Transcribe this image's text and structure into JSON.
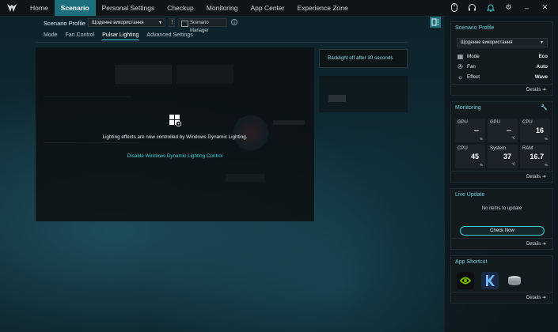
{
  "nav": {
    "items": [
      "Home",
      "Scenario",
      "Personal Settings",
      "Checkup",
      "Monitoring",
      "App Center",
      "Experience Zone"
    ],
    "active": "Scenario"
  },
  "scenario_bar": {
    "label": "Scenario Profile",
    "profile": "Щоденне використання",
    "manager_label": "Scenario Manager"
  },
  "subtabs": [
    "Mode",
    "Fan Control",
    "Pulsar Lighting",
    "Advanced Settings"
  ],
  "lighting": {
    "message": "Lighting effects are now controlled by Windows Dynamic Lighting.",
    "disable_link": "Disable Windows Dynamic Lighting Control",
    "backlight_option": "Backlight off after 30 seconds"
  },
  "scenario_card": {
    "title": "Scenario Profile",
    "profile": "Щоденне використання",
    "rows": [
      {
        "label": "Mode",
        "value": "Eco"
      },
      {
        "label": "Fan",
        "value": "Auto"
      },
      {
        "label": "Effect",
        "value": "Wave"
      }
    ],
    "details": "Details"
  },
  "monitoring_card": {
    "title": "Monitoring",
    "tiles": [
      {
        "label": "GPU",
        "value": "--",
        "unit": "%"
      },
      {
        "label": "GPU",
        "value": "--",
        "unit": "℃"
      },
      {
        "label": "CPU",
        "value": "16",
        "unit": "%"
      },
      {
        "label": "CPU",
        "value": "45",
        "unit": "%"
      },
      {
        "label": "System",
        "value": "37",
        "unit": "℃"
      },
      {
        "label": "RAM",
        "value": "16.7",
        "unit": "%"
      }
    ],
    "details": "Details"
  },
  "live_update_card": {
    "title": "Live Update",
    "empty": "No items to update",
    "button": "Check Now",
    "details": "Details"
  },
  "shortcut_card": {
    "title": "App Shortcut",
    "apps": [
      "nvidia-icon",
      "killer-icon",
      "storage-icon"
    ],
    "details": "Details"
  },
  "colors": {
    "accent": "#3fd1d6",
    "active_tab": "#1c6f7c"
  }
}
